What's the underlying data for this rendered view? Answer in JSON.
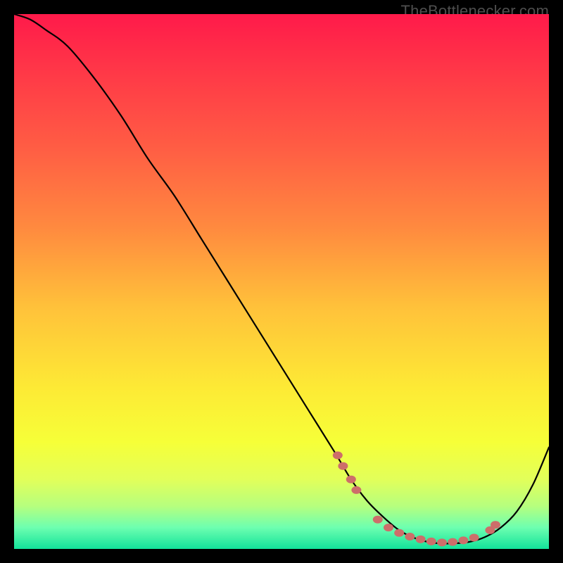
{
  "watermark": "TheBottlenecker.com",
  "chart_data": {
    "type": "line",
    "title": "",
    "xlabel": "",
    "ylabel": "",
    "xlim": [
      0,
      100
    ],
    "ylim": [
      0,
      100
    ],
    "legend": false,
    "grid": false,
    "background_gradient": {
      "orientation": "vertical",
      "stops": [
        {
          "pos": 0.0,
          "color": "#ff1a4a"
        },
        {
          "pos": 0.12,
          "color": "#ff3b47"
        },
        {
          "pos": 0.25,
          "color": "#ff5d44"
        },
        {
          "pos": 0.4,
          "color": "#ff8a3f"
        },
        {
          "pos": 0.55,
          "color": "#ffc23a"
        },
        {
          "pos": 0.7,
          "color": "#fdea35"
        },
        {
          "pos": 0.8,
          "color": "#f6ff38"
        },
        {
          "pos": 0.87,
          "color": "#e2ff5a"
        },
        {
          "pos": 0.92,
          "color": "#b6ff7e"
        },
        {
          "pos": 0.96,
          "color": "#6dffb0"
        },
        {
          "pos": 1.0,
          "color": "#12e29a"
        }
      ]
    },
    "series": [
      {
        "name": "bottleneck-curve",
        "color": "#000000",
        "x": [
          0,
          3,
          6,
          10,
          15,
          20,
          25,
          30,
          35,
          40,
          45,
          50,
          55,
          60,
          63,
          66,
          69,
          72,
          75,
          78,
          81,
          85,
          88,
          91,
          94,
          97,
          100
        ],
        "values": [
          100,
          99,
          97,
          94,
          88,
          81,
          73,
          66,
          58,
          50,
          42,
          34,
          26,
          18,
          13,
          9,
          6,
          3.5,
          2,
          1.2,
          1,
          1.3,
          2.2,
          4,
          7,
          12,
          19
        ]
      }
    ],
    "markers": {
      "name": "highlighted-points",
      "color": "#cd6e6a",
      "points": [
        {
          "x": 60.5,
          "y": 17.5
        },
        {
          "x": 61.5,
          "y": 15.5
        },
        {
          "x": 63.0,
          "y": 13.0
        },
        {
          "x": 64.0,
          "y": 11.0
        },
        {
          "x": 68.0,
          "y": 5.5
        },
        {
          "x": 70.0,
          "y": 4.0
        },
        {
          "x": 72.0,
          "y": 3.0
        },
        {
          "x": 74.0,
          "y": 2.3
        },
        {
          "x": 76.0,
          "y": 1.8
        },
        {
          "x": 78.0,
          "y": 1.4
        },
        {
          "x": 80.0,
          "y": 1.2
        },
        {
          "x": 82.0,
          "y": 1.3
        },
        {
          "x": 84.0,
          "y": 1.6
        },
        {
          "x": 86.0,
          "y": 2.1
        },
        {
          "x": 89.0,
          "y": 3.5
        },
        {
          "x": 90.0,
          "y": 4.5
        }
      ]
    }
  }
}
